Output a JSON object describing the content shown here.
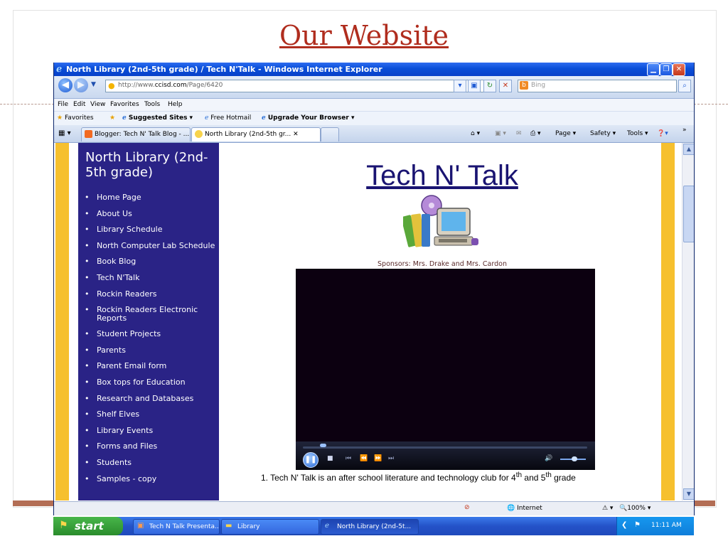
{
  "slide": {
    "title": "Our Website"
  },
  "browser": {
    "window_title": "North Library (2nd-5th grade) / Tech N'Talk - Windows Internet Explorer",
    "address": {
      "prefix": "http://www.",
      "domain": "ccisd.com",
      "path": "/Page/6420"
    },
    "search_placeholder": "Bing",
    "menu": [
      "File",
      "Edit",
      "View",
      "Favorites",
      "Tools",
      "Help"
    ],
    "favorites": {
      "label": "Favorites",
      "items": [
        {
          "label": "Suggested Sites ▾"
        },
        {
          "label": "Free Hotmail"
        },
        {
          "label": "Upgrade Your Browser ▾"
        }
      ]
    },
    "tabs": [
      {
        "label": "Blogger: Tech N' Talk Blog - ..."
      },
      {
        "label": "North Library (2nd-5th gr... ✕"
      }
    ],
    "commands": {
      "page": "Page ▾",
      "safety": "Safety ▾",
      "tools": "Tools ▾"
    },
    "status": {
      "zone": "Internet",
      "zoom": "100%"
    }
  },
  "page": {
    "sidebar": {
      "title": "North Library (2nd-5th grade)",
      "items": [
        "Home Page",
        "About Us",
        "Library Schedule",
        "North Computer Lab Schedule",
        "Book Blog",
        "Tech N'Talk",
        "Rockin Readers",
        "Rockin Readers Electronic Reports",
        "Student Projects",
        "Parents",
        "Parent Email form",
        "Box tops for Education",
        "Research and Databases",
        "Shelf Elves",
        "Library Events",
        "Forms and Files",
        "Students",
        "Samples - copy"
      ]
    },
    "heading": "Tech N' Talk",
    "sponsors": "Sponsors: Mrs. Drake and Mrs. Cardon",
    "caption": {
      "prefix": "1.  Tech N' Talk is an after school  literature and technology club for 4",
      "sup1": "th",
      "mid": " and 5",
      "sup2": "th",
      "suffix": " grade"
    }
  },
  "taskbar": {
    "start": "start",
    "tasks": [
      {
        "label": "Tech N Talk Presenta..."
      },
      {
        "label": "Library"
      },
      {
        "label": "North Library (2nd-5t..."
      }
    ],
    "clock": "11:11 AM"
  }
}
